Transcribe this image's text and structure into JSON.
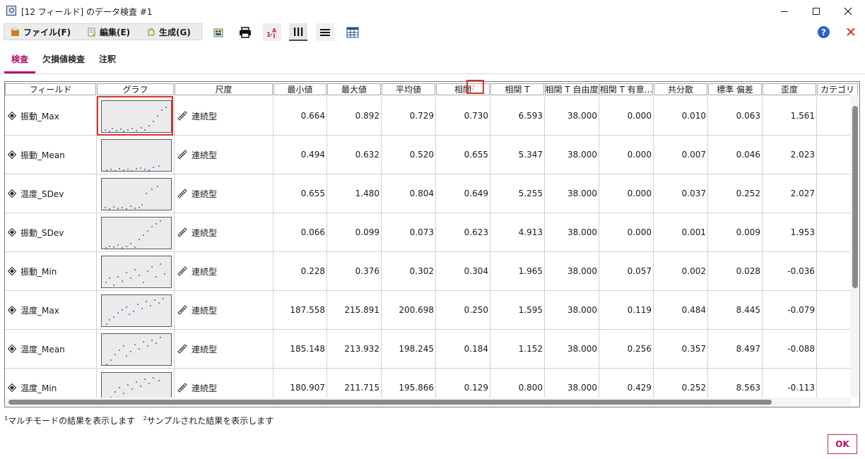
{
  "window": {
    "title": "[12 フィールド] のデータ検査 #1"
  },
  "menu": {
    "file": "ファイル(F)",
    "edit": "編集(E)",
    "generate": "生成(G)"
  },
  "tabs": [
    "検査",
    "欠損値検査",
    "注釈"
  ],
  "table": {
    "columns": [
      "フィールド",
      "グラフ",
      "尺度",
      "最小値",
      "最大値",
      "平均値",
      "相関",
      "相関 T",
      "相関 T 自由度",
      "相関 T 有意...",
      "共分散",
      "標準 偏差",
      "歪度",
      "カテゴリ"
    ],
    "rows": [
      {
        "field": "振動_Max",
        "measure": "連続型",
        "min": "0.664",
        "max": "0.892",
        "mean": "0.729",
        "corr": "0.730",
        "corr_t": "6.593",
        "corr_t_df": "38.000",
        "corr_t_sig": "0.000",
        "cov": "0.010",
        "sd": "0.063",
        "skew": "1.561"
      },
      {
        "field": "振動_Mean",
        "measure": "連続型",
        "min": "0.494",
        "max": "0.632",
        "mean": "0.520",
        "corr": "0.655",
        "corr_t": "5.347",
        "corr_t_df": "38.000",
        "corr_t_sig": "0.000",
        "cov": "0.007",
        "sd": "0.046",
        "skew": "2.023"
      },
      {
        "field": "温度_SDev",
        "measure": "連続型",
        "min": "0.655",
        "max": "1.480",
        "mean": "0.804",
        "corr": "0.649",
        "corr_t": "5.255",
        "corr_t_df": "38.000",
        "corr_t_sig": "0.000",
        "cov": "0.037",
        "sd": "0.252",
        "skew": "2.027"
      },
      {
        "field": "振動_SDev",
        "measure": "連続型",
        "min": "0.066",
        "max": "0.099",
        "mean": "0.073",
        "corr": "0.623",
        "corr_t": "4.913",
        "corr_t_df": "38.000",
        "corr_t_sig": "0.000",
        "cov": "0.001",
        "sd": "0.009",
        "skew": "1.953"
      },
      {
        "field": "振動_Min",
        "measure": "連続型",
        "min": "0.228",
        "max": "0.376",
        "mean": "0.302",
        "corr": "0.304",
        "corr_t": "1.965",
        "corr_t_df": "38.000",
        "corr_t_sig": "0.057",
        "cov": "0.002",
        "sd": "0.028",
        "skew": "-0.036"
      },
      {
        "field": "温度_Max",
        "measure": "連続型",
        "min": "187.558",
        "max": "215.891",
        "mean": "200.698",
        "corr": "0.250",
        "corr_t": "1.595",
        "corr_t_df": "38.000",
        "corr_t_sig": "0.119",
        "cov": "0.484",
        "sd": "8.445",
        "skew": "-0.079"
      },
      {
        "field": "温度_Mean",
        "measure": "連続型",
        "min": "185.148",
        "max": "213.932",
        "mean": "198.245",
        "corr": "0.184",
        "corr_t": "1.152",
        "corr_t_df": "38.000",
        "corr_t_sig": "0.256",
        "cov": "0.357",
        "sd": "8.497",
        "skew": "-0.088"
      },
      {
        "field": "温度_Min",
        "measure": "連続型",
        "min": "180.907",
        "max": "211.715",
        "mean": "195.866",
        "corr": "0.129",
        "corr_t": "0.800",
        "corr_t_df": "38.000",
        "corr_t_sig": "0.429",
        "cov": "0.252",
        "sd": "8.563",
        "skew": "-0.113"
      }
    ]
  },
  "footnote": {
    "sup1": "1",
    "text1": "マルチモードの結果を表示します",
    "sup2": "2",
    "text2": "サンプルされた結果を表示します"
  },
  "buttons": {
    "ok": "OK",
    "help": "?"
  },
  "icons": {
    "app": "data-audit-icon",
    "file": "folder-icon",
    "edit": "edit-icon",
    "generate": "generate-icon",
    "export": "export-icon",
    "print": "print-icon",
    "sort": "sort-icon",
    "columns": "columns-icon",
    "list": "list-icon",
    "table": "table-icon",
    "help": "help-icon",
    "close": "close-icon",
    "field": "continuous-field-icon",
    "measure": "ruler-icon"
  },
  "colors": {
    "accent": "#b3106a",
    "highlight": "#d9342b",
    "help": "#2a63c0",
    "close_red": "#e0201a"
  }
}
